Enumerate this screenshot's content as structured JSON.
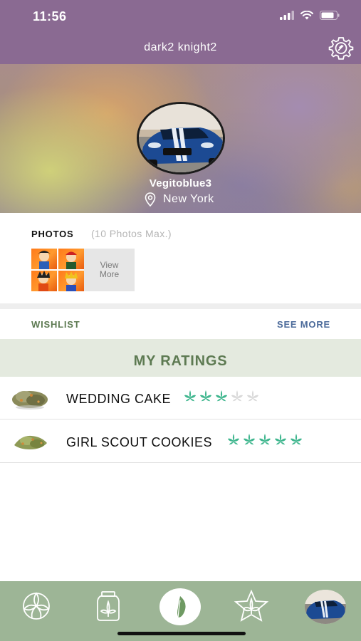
{
  "status": {
    "time": "11:56",
    "signal_icon": "signal-icon",
    "wifi_icon": "wifi-icon",
    "battery_icon": "battery-icon"
  },
  "header": {
    "title": "dark2 knight2",
    "settings_icon": "gear-icon"
  },
  "profile": {
    "username": "Vegitoblue3",
    "location": "New York",
    "location_icon": "location-pin-icon"
  },
  "photos": {
    "title": "PHOTOS",
    "subtitle": "(10 Photos Max.)",
    "view_more_line1": "View",
    "view_more_line2": "More"
  },
  "wishlist": {
    "label": "WISHLIST",
    "see_more": "SEE MORE"
  },
  "ratings": {
    "title": "MY RATINGS",
    "items": [
      {
        "name": "WEDDING CAKE",
        "rating": 3,
        "max": 5
      },
      {
        "name": "GIRL SCOUT COOKIES",
        "rating": 5,
        "max": 5
      }
    ]
  },
  "tabbar": {
    "tabs": [
      "explore-icon",
      "jar-icon",
      "leaf-icon",
      "star-leaf-icon",
      "profile-avatar"
    ]
  },
  "colors": {
    "header": "#8a6a92",
    "accent_green": "#5d7a52",
    "link_blue": "#4b6a9a",
    "tabbar": "#9db596",
    "star_active": "#3fb68e",
    "star_inactive": "#d9d9d9"
  }
}
